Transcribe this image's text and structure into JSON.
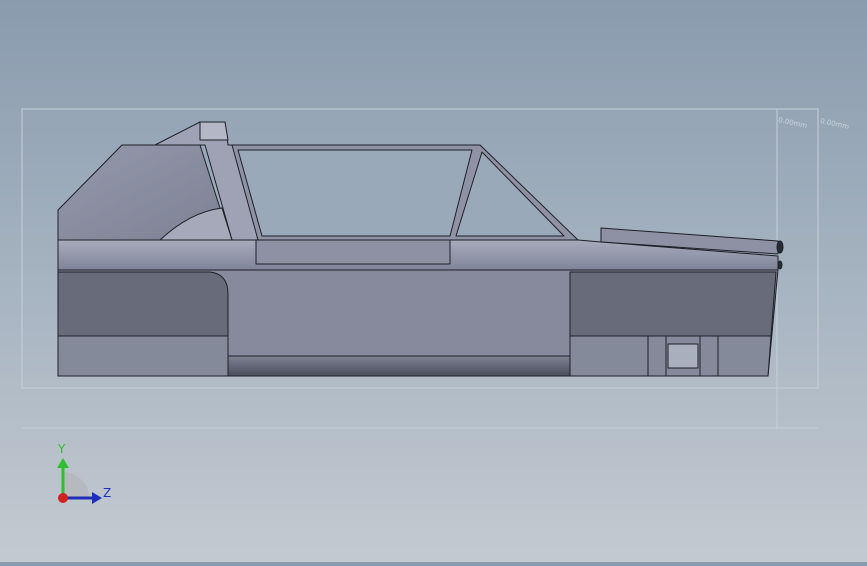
{
  "viewport": {
    "background_top": "#8a9bae",
    "background_bottom": "#c3cad1",
    "dimension_label_1": "0.00mm",
    "dimension_label_2": "0.00mm"
  },
  "triad": {
    "y_label": "Y",
    "z_label": "Z",
    "y_color": "#2fbf2f",
    "z_color": "#1f2fb8",
    "origin_color": "#d02020"
  },
  "model": {
    "body_color": "#858a9b",
    "panel_dark_color": "#676b7a",
    "edge_color": "#1e2028"
  }
}
